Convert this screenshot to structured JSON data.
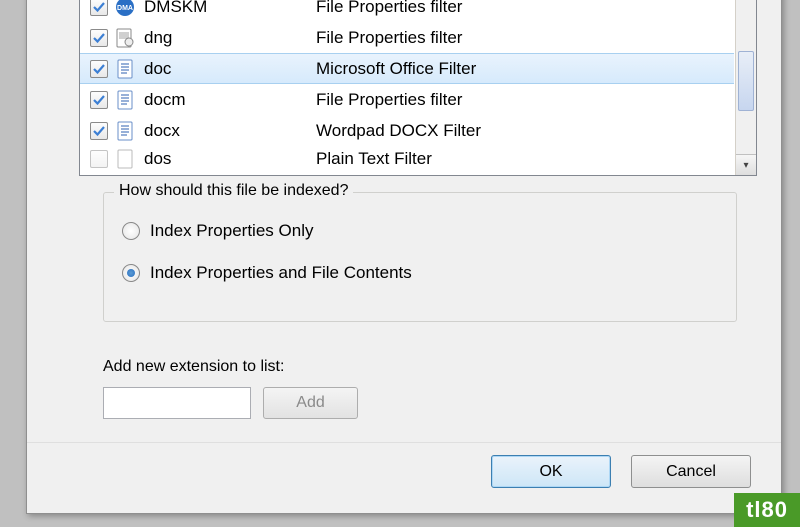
{
  "list": {
    "items": [
      {
        "checked": true,
        "ext": "DMSKM",
        "desc": "File Properties filter",
        "icon": "dma"
      },
      {
        "checked": true,
        "ext": "dng",
        "desc": "File Properties filter",
        "icon": "dng"
      },
      {
        "checked": true,
        "ext": "doc",
        "desc": "Microsoft Office Filter",
        "icon": "doc",
        "selected": true
      },
      {
        "checked": true,
        "ext": "docm",
        "desc": "File Properties filter",
        "icon": "doc"
      },
      {
        "checked": true,
        "ext": "docx",
        "desc": "Wordpad DOCX Filter",
        "icon": "doc"
      },
      {
        "checked": false,
        "ext": "dos",
        "desc": "Plain Text Filter",
        "icon": "generic",
        "partial": true
      }
    ]
  },
  "group": {
    "title": "How should this file be indexed?",
    "option1": "Index Properties Only",
    "option2": "Index Properties and File Contents",
    "selected": 2
  },
  "add": {
    "label": "Add new extension to list:",
    "value": "",
    "button": "Add"
  },
  "buttons": {
    "ok": "OK",
    "cancel": "Cancel"
  },
  "watermark": "tl80"
}
